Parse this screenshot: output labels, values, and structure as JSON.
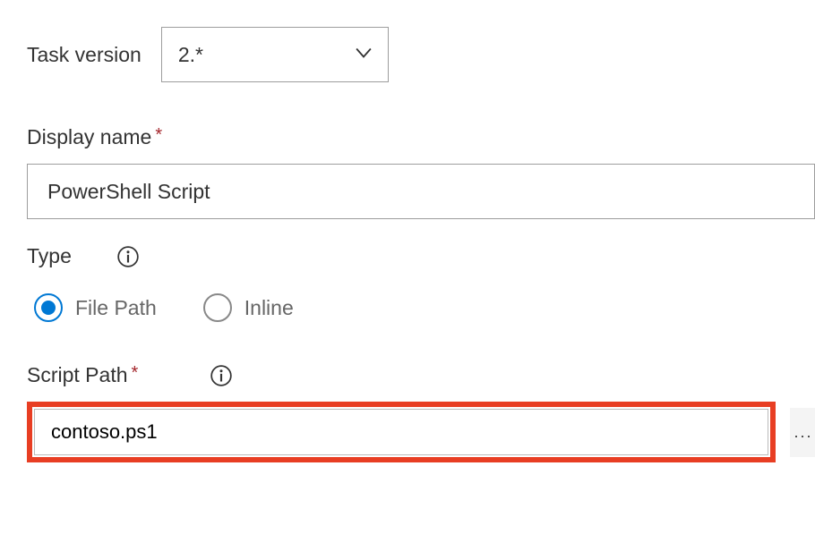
{
  "taskVersion": {
    "label": "Task version",
    "value": "2.*"
  },
  "displayName": {
    "label": "Display name",
    "value": "PowerShell Script"
  },
  "typeSection": {
    "label": "Type",
    "options": {
      "filePath": "File Path",
      "inline": "Inline"
    },
    "selected": "filePath"
  },
  "scriptPath": {
    "label": "Script Path",
    "value": "contoso.ps1"
  },
  "ellipsisLabel": "..."
}
